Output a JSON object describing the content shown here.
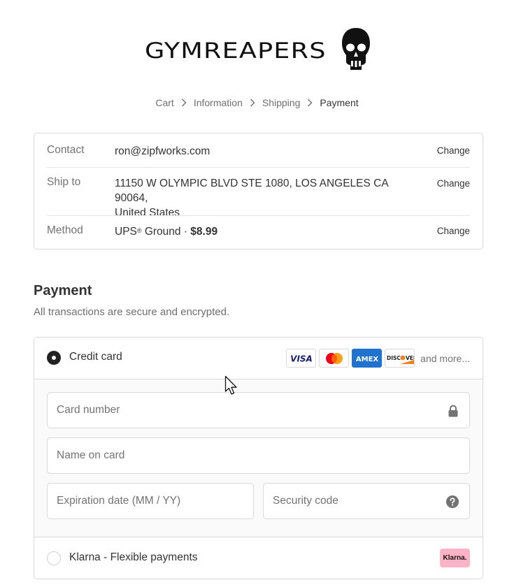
{
  "brand": {
    "logo_text": "GYMREAPERS"
  },
  "breadcrumb": {
    "items": [
      "Cart",
      "Information",
      "Shipping",
      "Payment"
    ]
  },
  "review": {
    "contact": {
      "label": "Contact",
      "value": "ron@zipfworks.com",
      "action": "Change"
    },
    "ship_to": {
      "label": "Ship to",
      "value_line1": "11150 W OLYMPIC BLVD STE 1080, LOS ANGELES CA 90064,",
      "value_line2": "United States",
      "action": "Change"
    },
    "method": {
      "label": "Method",
      "carrier": "UPS",
      "reg": "®",
      "service": " Ground · ",
      "price": "$8.99",
      "action": "Change"
    }
  },
  "payment": {
    "title": "Payment",
    "subtitle": "All transactions are secure and encrypted.",
    "credit_card": {
      "label": "Credit card",
      "selected": true,
      "card_brands": [
        "VISA",
        "Mastercard",
        "AMEX",
        "DISCOVER"
      ],
      "and_more": "and more...",
      "fields": {
        "card_number": {
          "placeholder": "Card number",
          "value": ""
        },
        "name_on_card": {
          "placeholder": "Name on card",
          "value": ""
        },
        "expiration": {
          "placeholder": "Expiration date (MM / YY)",
          "value": ""
        },
        "security_code": {
          "placeholder": "Security code",
          "value": ""
        }
      }
    },
    "klarna": {
      "label": "Klarna - Flexible payments",
      "selected": false,
      "badge": "Klarna."
    }
  },
  "icons": {
    "chevron": "chevron-right-icon",
    "lock": "lock-icon",
    "help": "question-circle-icon",
    "skull": "skull-logo-icon",
    "cursor": "mouse-cursor-icon"
  },
  "colors": {
    "text": "#333333",
    "muted": "#737373",
    "border": "#d9d9d9",
    "amex_blue": "#1f72cd",
    "klarna_pink": "#ffb3c7",
    "mastercard_red": "#eb001b",
    "mastercard_orange": "#f79e1b",
    "visa_blue": "#1a1f71",
    "discover_orange": "#f58220"
  }
}
